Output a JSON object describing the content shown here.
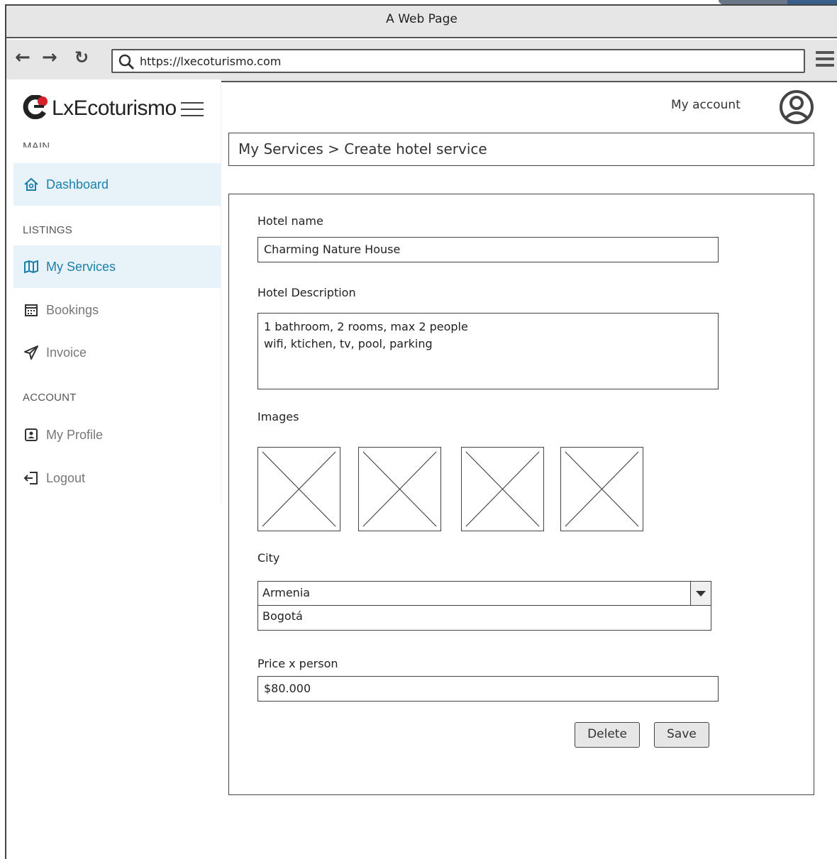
{
  "browser": {
    "window_title": "A Web Page",
    "url": "https://lxecoturismo.com",
    "nav_icons": [
      "back-arrow-icon",
      "forward-arrow-icon",
      "reload-icon",
      "search-icon",
      "menu-icon"
    ]
  },
  "brand": {
    "name": "LxEcoturismo",
    "accent": "#d6202a"
  },
  "header": {
    "account_label": "My account"
  },
  "sidebar": {
    "sections": [
      {
        "label": "MAIN"
      },
      {
        "label": "LISTINGS"
      },
      {
        "label": "ACCOUNT"
      }
    ],
    "items": [
      {
        "label": "Dashboard",
        "icon": "home-icon",
        "active": true
      },
      {
        "label": "My Services",
        "icon": "map-icon",
        "active": true
      },
      {
        "label": "Bookings",
        "icon": "calendar-icon",
        "active": false
      },
      {
        "label": "Invoice",
        "icon": "paper-plane-icon",
        "active": false
      },
      {
        "label": "My Profile",
        "icon": "profile-icon",
        "active": false
      },
      {
        "label": "Logout",
        "icon": "logout-icon",
        "active": false
      }
    ],
    "active_color": "#1b7fab",
    "active_bg": "#e8f3f9"
  },
  "breadcrumb": "My Services > Create  hotel service",
  "form": {
    "hotel_name_label": "Hotel name",
    "hotel_name_value": "Charming Nature House",
    "description_label": "Hotel Description",
    "description_line1": "1 bathroom, 2 rooms, max 2 people",
    "description_line2": "wifi, ktichen, tv, pool, parking",
    "images_label": "Images",
    "image_count": 4,
    "city_label": "City",
    "city_selected": "Armenia",
    "city_option": "Bogotá",
    "price_label": "Price x person",
    "price_value": "$80.000",
    "delete_label": "Delete",
    "save_label": "Save"
  }
}
